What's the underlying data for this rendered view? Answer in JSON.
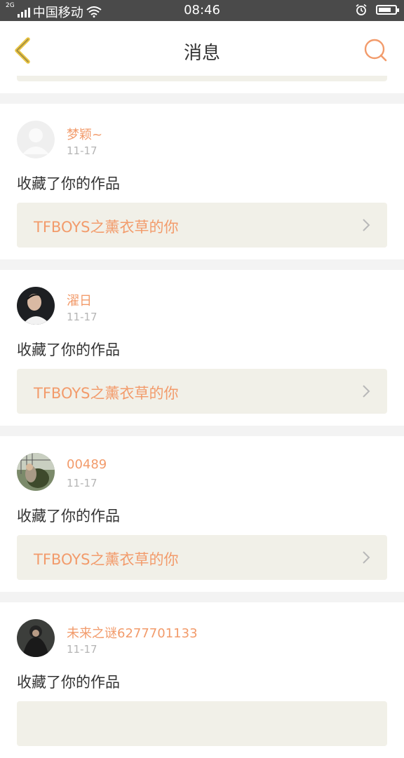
{
  "status_bar": {
    "network_badge": "2G",
    "carrier": "中国移动",
    "time": "08:46",
    "battery_percent": 75
  },
  "header": {
    "title": "消息",
    "back_icon": "chevron-left-icon",
    "search_icon": "search-icon"
  },
  "colors": {
    "accent": "#f29b6b",
    "back_arrow": "#e8c341",
    "card_bg": "#f1f0e8",
    "page_bg": "#f3f3f3"
  },
  "notifications": [
    {
      "username": "梦颖~",
      "date": "11-17",
      "action": "收藏了你的作品",
      "work_title": "TFBOYS之薰衣草的你",
      "avatar": "default-avatar"
    },
    {
      "username": "濯日",
      "date": "11-17",
      "action": "收藏了你的作品",
      "work_title": "TFBOYS之薰衣草的你",
      "avatar": "photo-avatar"
    },
    {
      "username": "00489",
      "date": "11-17",
      "action": "收藏了你的作品",
      "work_title": "TFBOYS之薰衣草的你",
      "avatar": "photo-avatar"
    },
    {
      "username": "未来之谜6277701133",
      "date": "11-17",
      "action": "收藏了你的作品",
      "work_title": "",
      "avatar": "photo-avatar"
    }
  ]
}
